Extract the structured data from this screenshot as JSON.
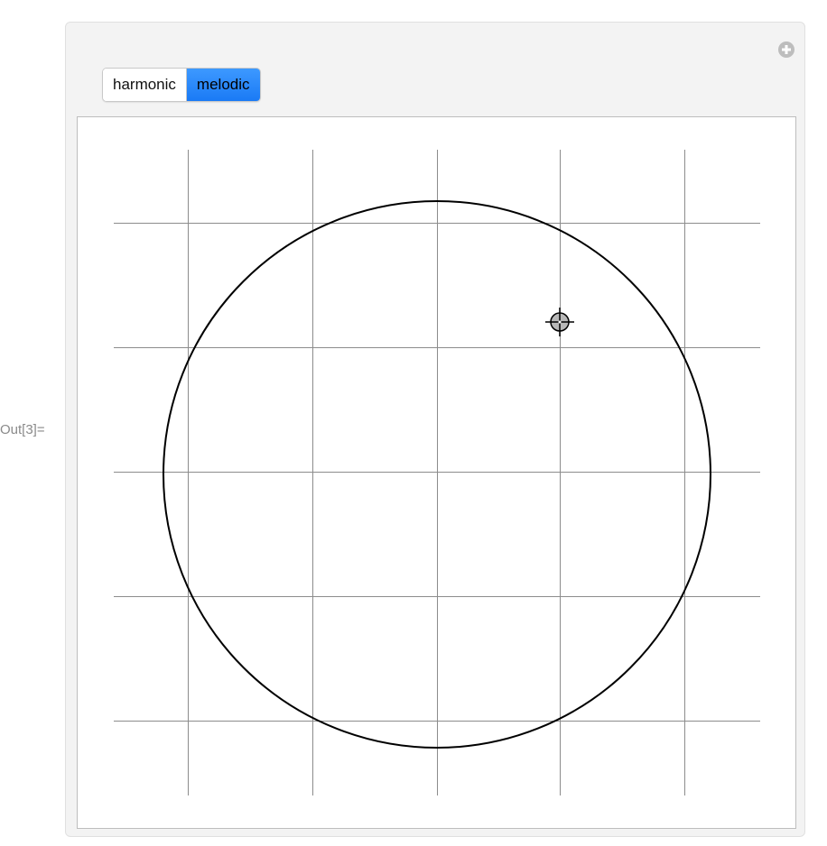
{
  "cell": {
    "out_label": "Out[3]="
  },
  "panel": {
    "add_icon": "plus-circle-icon"
  },
  "toggle": {
    "options": [
      "harmonic",
      "melodic"
    ],
    "selected": "melodic"
  },
  "plot": {
    "grid": true,
    "circle": {
      "stroke": "#000000"
    },
    "locator_icon": "crosshair-locator-icon",
    "colors": {
      "grid": "#8c8c8c",
      "selected_button": "#2285f8"
    }
  }
}
